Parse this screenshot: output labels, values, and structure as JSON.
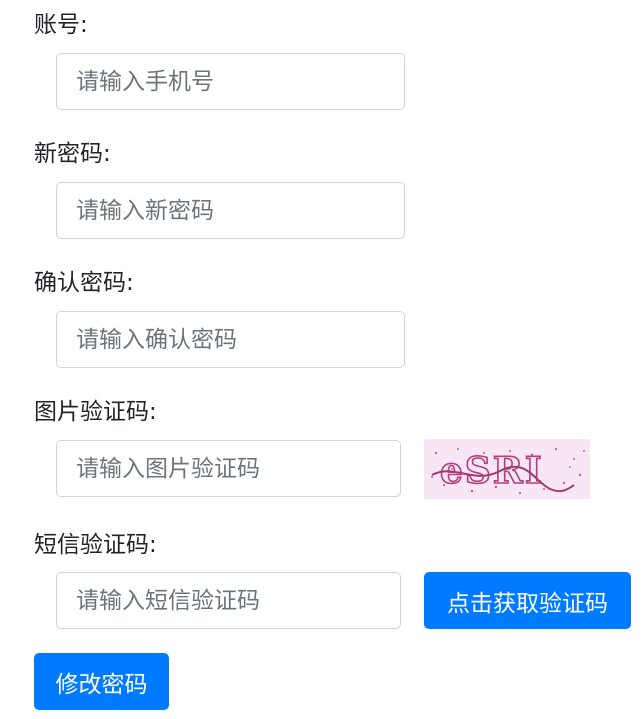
{
  "form": {
    "account": {
      "label": "账号:",
      "placeholder": "请输入手机号",
      "value": ""
    },
    "new_password": {
      "label": "新密码:",
      "placeholder": "请输入新密码",
      "value": ""
    },
    "confirm_password": {
      "label": "确认密码:",
      "placeholder": "请输入确认密码",
      "value": ""
    },
    "image_captcha": {
      "label": "图片验证码:",
      "placeholder": "请输入图片验证码",
      "value": "",
      "captcha_text": "eSRI"
    },
    "sms_code": {
      "label": "短信验证码:",
      "placeholder": "请输入短信验证码",
      "value": ""
    },
    "get_code_button": "点击获取验证码",
    "submit_button": "修改密码"
  },
  "colors": {
    "primary": "#007bff",
    "input_border": "#ced4da",
    "placeholder": "#6c757d",
    "text": "#212529",
    "captcha_bg": "#f9e6f4",
    "captcha_ink": "#b0407e"
  }
}
